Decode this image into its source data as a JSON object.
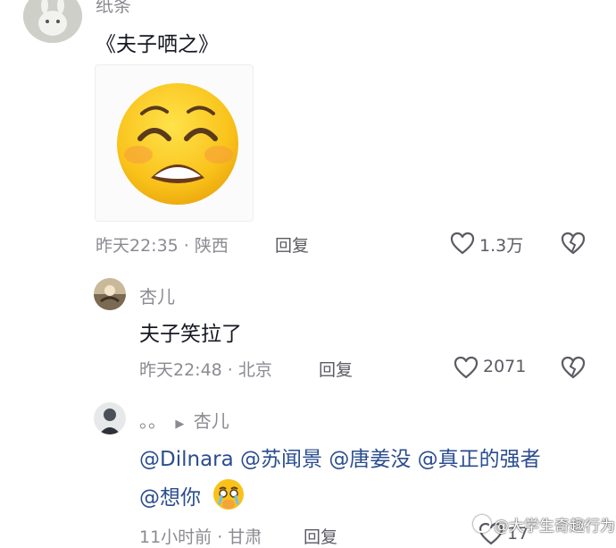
{
  "comment_main": {
    "username": "纸条",
    "text": "《夫子哂之》",
    "meta": "昨天22:35 · 陕西",
    "reply_label": "回复",
    "like_count": "1.3万"
  },
  "reply_1": {
    "username": "杏儿",
    "text": "夫子笑拉了",
    "meta": "昨天22:48 · 北京",
    "reply_label": "回复",
    "like_count": "2071"
  },
  "reply_2": {
    "username_prefix": "。。",
    "reply_to": "杏儿",
    "mentions_line1": [
      "@Dilnara",
      "@苏闻景",
      "@唐姜没",
      "@真正的强者"
    ],
    "mentions_line2": "@想你",
    "meta": "11小时前 · 甘肃",
    "reply_label": "回复",
    "like_count": "17"
  },
  "watermark": "@大学生奇趣行为",
  "colors": {
    "text": "#161823",
    "secondary": "#8a8b91",
    "mention": "#2b4d8f",
    "emoji_yellow": "#f9c21a"
  }
}
